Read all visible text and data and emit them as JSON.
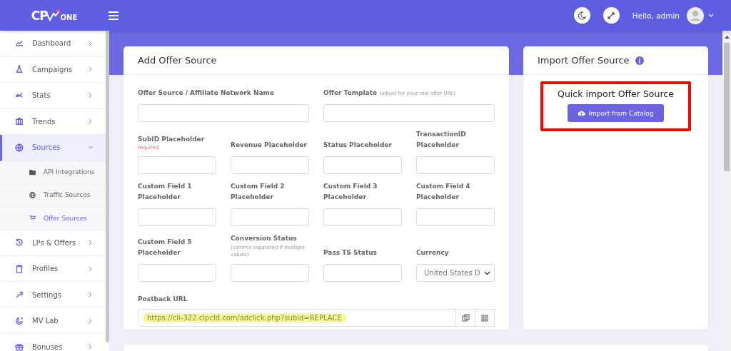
{
  "header": {
    "logo": {
      "mark": "CP",
      "word": "ONE"
    },
    "greeting": "Hello, admin"
  },
  "sidebar": {
    "items": [
      {
        "label": "Dashboard",
        "selected": false,
        "expanded": false
      },
      {
        "label": "Campaigns",
        "selected": false,
        "expanded": false
      },
      {
        "label": "Stats",
        "selected": false,
        "expanded": false
      },
      {
        "label": "Trends",
        "selected": false,
        "expanded": false
      },
      {
        "label": "Sources",
        "selected": true,
        "expanded": true,
        "children": [
          {
            "label": "API Integrations",
            "selected": false
          },
          {
            "label": "Traffic Sources",
            "selected": false
          },
          {
            "label": "Offer Sources",
            "selected": true
          }
        ]
      },
      {
        "label": "LPs & Offers",
        "selected": false,
        "expanded": false
      },
      {
        "label": "Profiles",
        "selected": false,
        "expanded": false
      },
      {
        "label": "Settings",
        "selected": false,
        "expanded": false
      },
      {
        "label": "MV Lab",
        "selected": false,
        "expanded": false
      },
      {
        "label": "Bonuses",
        "selected": false,
        "expanded": false
      }
    ]
  },
  "add_card": {
    "title": "Add Offer Source",
    "fields": [
      {
        "kind": "wide",
        "label": "Offer Source / Affiliate Network Name"
      },
      {
        "kind": "wide",
        "label": "Offer Template",
        "hint": "(adjust for your real offer URL)"
      },
      {
        "kind": "text",
        "label": "SubID Placeholder",
        "note": "required"
      },
      {
        "kind": "text",
        "label": "Revenue Placeholder"
      },
      {
        "kind": "text",
        "label": "Status Placeholder"
      },
      {
        "kind": "text",
        "label": "TransactionID Placeholder"
      },
      {
        "kind": "text",
        "label": "Custom Field 1 Placeholder"
      },
      {
        "kind": "text",
        "label": "Custom Field 2 Placeholder"
      },
      {
        "kind": "text",
        "label": "Custom Field 3 Placeholder"
      },
      {
        "kind": "text",
        "label": "Custom Field 4 Placeholder"
      },
      {
        "kind": "text",
        "label": "Custom Field 5 Placeholder"
      },
      {
        "kind": "text",
        "label": "Conversion Status",
        "hint": "(comma separated if multiple values)"
      },
      {
        "kind": "text",
        "label": "Pass TS Status"
      },
      {
        "kind": "select",
        "label": "Currency",
        "value": "United States D"
      }
    ],
    "postback": {
      "label": "Postback URL",
      "value": "https://cli-322.clpcld.com/adclick.php?subid=REPLACE",
      "highlighted": true
    }
  },
  "import_card": {
    "title": "Import Offer Source",
    "heading": "Quick import Offer Source",
    "button": "Import from Catalog",
    "annotated": true
  }
}
